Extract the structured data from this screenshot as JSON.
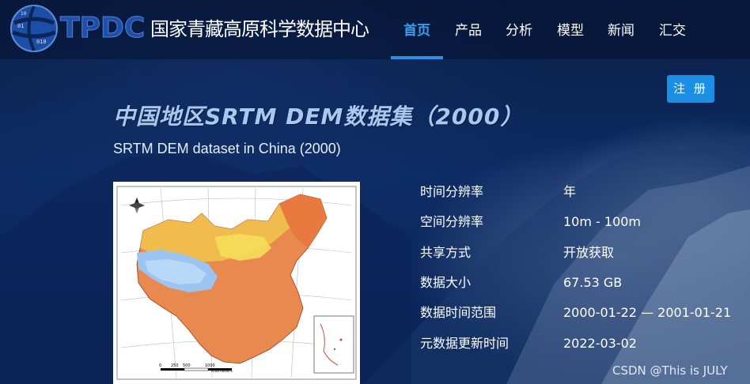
{
  "header": {
    "logo_text": "TPDC",
    "site_name": "国家青藏高原科学数据中心",
    "nav": [
      {
        "label": "首页",
        "active": true
      },
      {
        "label": "产品",
        "active": false
      },
      {
        "label": "分析",
        "active": false
      },
      {
        "label": "模型",
        "active": false
      },
      {
        "label": "新闻",
        "active": false
      },
      {
        "label": "汇交",
        "active": false
      }
    ],
    "register_label": "注 册"
  },
  "dataset": {
    "title_cn": "中国地区SRTM DEM数据集（2000）",
    "title_en": "SRTM DEM dataset in China (2000)",
    "scale_label": "Kilometers",
    "scale_ticks": [
      "0",
      "250",
      "500",
      "1000"
    ],
    "info": [
      {
        "label": "时间分辨率",
        "value": "年"
      },
      {
        "label": "空间分辨率",
        "value": "10m - 100m"
      },
      {
        "label": "共享方式",
        "value": "开放获取"
      },
      {
        "label": "数据大小",
        "value": "67.53 GB"
      },
      {
        "label": "数据时间范围",
        "value": "2000-01-22 — 2001-01-21"
      },
      {
        "label": "元数据更新时间",
        "value": "2022-03-02"
      }
    ]
  },
  "watermark": "CSDN @This is JULY",
  "colors": {
    "accent": "#1a8fe3",
    "nav_active": "#3a9df0",
    "background": "#0a1f4a"
  }
}
